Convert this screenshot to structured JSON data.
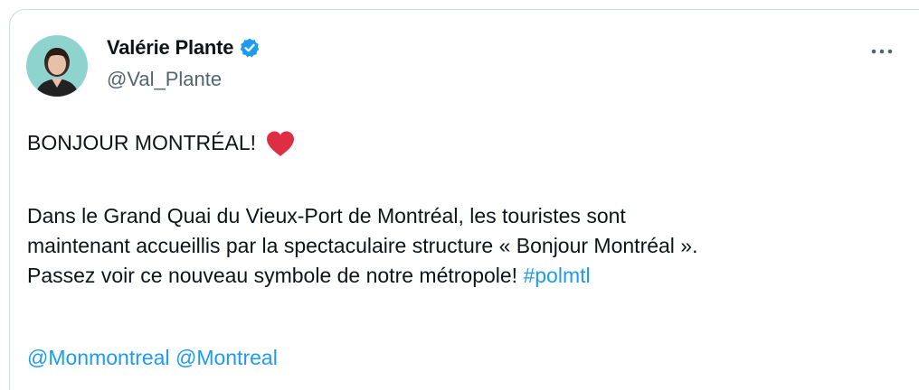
{
  "author": {
    "display_name": "Valérie Plante",
    "handle": "@Val_Plante",
    "verified": true,
    "avatar_bg": "#8fd3cf"
  },
  "post": {
    "headline": "BONJOUR MONTRÉAL!",
    "headline_emoji": "heart-icon",
    "paragraph": [
      "Dans le Grand Quai du Vieux-Port de Montréal, les touristes sont",
      "maintenant accueillis par la spectaculaire structure « Bonjour Montréal ».",
      "Passez voir ce nouveau symbole de notre métropole! "
    ],
    "hashtag": "#polmtl",
    "mentions": [
      "@Monmontreal",
      "@Montreal"
    ]
  },
  "colors": {
    "link": "#1d9bf0",
    "verified": "#1d9bf0",
    "heart": "#dd2e44",
    "text": "#0f1419",
    "muted": "#536471"
  }
}
